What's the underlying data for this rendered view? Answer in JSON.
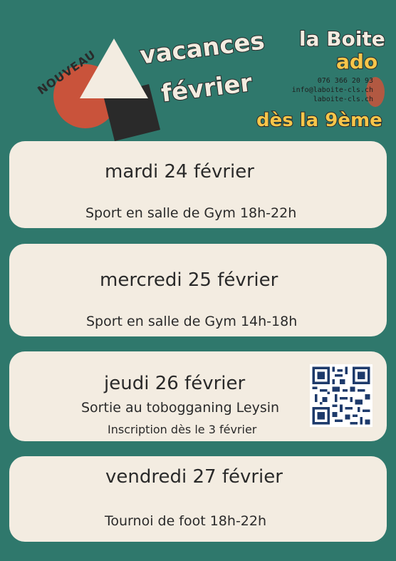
{
  "header": {
    "nouveau": "NOUVEAU",
    "title_line1": "vacances",
    "title_line2": "février",
    "brand_name": "la Boite",
    "brand_sub": "ado",
    "phone": "076 366 20 93",
    "email": "info@laboite-cls.ch",
    "website": "laboite-cls.ch",
    "grade": "dès la 9ème"
  },
  "colors": {
    "background": "#2f786c",
    "card": "#f3ece1",
    "accent_red": "#c9533b",
    "accent_yellow": "#f6c64a",
    "dark": "#2a2a2a"
  },
  "events": [
    {
      "day": "mardi 24 février",
      "detail": "Sport en salle de Gym 18h-22h"
    },
    {
      "day": "mercredi 25 février",
      "detail": "Sport en salle de Gym 14h-18h"
    },
    {
      "day": "jeudi 26 février",
      "detail": "Sortie au tobogganing Leysin",
      "note": "Inscription dès le 3 février",
      "qr_icon": "qr-code-icon"
    },
    {
      "day": "vendredi 27 février",
      "detail": "Tournoi de foot 18h-22h"
    }
  ]
}
